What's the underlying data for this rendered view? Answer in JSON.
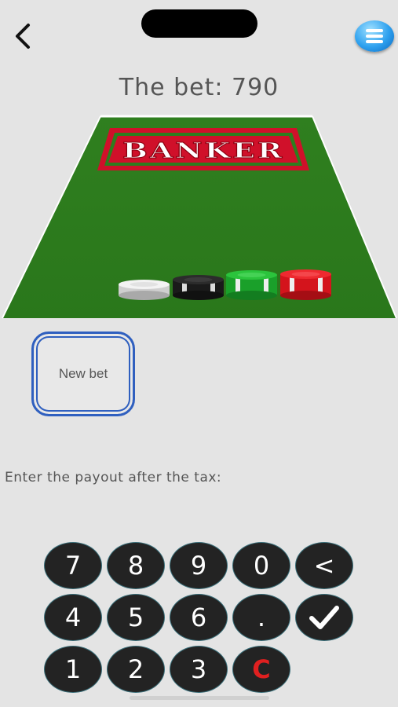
{
  "header": {
    "back_icon": "chevron-left-icon",
    "menu_icon": "hamburger-menu-icon",
    "title": "The bet: 790"
  },
  "table": {
    "label": "BANKER",
    "felt_color": "#2e7d1e",
    "label_color": "#d0102a",
    "chips": [
      {
        "color": "white"
      },
      {
        "color": "black"
      },
      {
        "color": "green"
      },
      {
        "color": "red"
      }
    ]
  },
  "new_bet_label": "New bet",
  "prompt": "Enter the payout after the tax:",
  "keypad": {
    "keys": [
      "7",
      "8",
      "9",
      "0",
      "<",
      "4",
      "5",
      "6",
      ".",
      "✓",
      "1",
      "2",
      "3",
      "C"
    ]
  }
}
